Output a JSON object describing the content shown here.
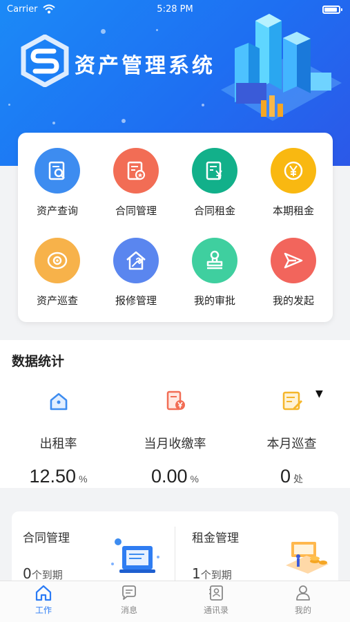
{
  "status_bar": {
    "carrier": "Carrier",
    "time": "5:28 PM"
  },
  "banner": {
    "title": "资产管理系统"
  },
  "quick_menu": [
    {
      "label": "资产查询",
      "icon": "search-doc-icon",
      "color": "#3d8cf0"
    },
    {
      "label": "合同管理",
      "icon": "contract-icon",
      "color": "#f26d55"
    },
    {
      "label": "合同租金",
      "icon": "rent-doc-icon",
      "color": "#12b08a"
    },
    {
      "label": "本期租金",
      "icon": "yen-icon",
      "color": "#f9b811"
    },
    {
      "label": "资产巡查",
      "icon": "eye-icon",
      "color": "#f7b24a"
    },
    {
      "label": "报修管理",
      "icon": "repair-house-icon",
      "color": "#5a86ef"
    },
    {
      "label": "我的审批",
      "icon": "stamp-icon",
      "color": "#3fcf9f"
    },
    {
      "label": "我的发起",
      "icon": "send-icon",
      "color": "#f2655c"
    }
  ],
  "stats": {
    "title": "数据统计",
    "items": [
      {
        "label": "出租率",
        "value": "12.50",
        "unit": "%",
        "icon": "house-icon",
        "color": "#3d8cf0"
      },
      {
        "label": "当月收缴率",
        "value": "0.00",
        "unit": "%",
        "icon": "bill-icon",
        "color": "#f26d55"
      },
      {
        "label": "本月巡查",
        "value": "0",
        "unit": "处",
        "icon": "checklist-icon",
        "color": "#f5b62a"
      }
    ]
  },
  "management": {
    "contract": {
      "title": "合同管理",
      "count": "0",
      "count_unit": "个到期"
    },
    "rent": {
      "title": "租金管理",
      "count": "1",
      "count_unit": "个到期"
    }
  },
  "tabs": [
    {
      "label": "工作",
      "icon": "home-icon",
      "active": true
    },
    {
      "label": "消息",
      "icon": "chat-icon",
      "active": false
    },
    {
      "label": "通讯录",
      "icon": "contacts-icon",
      "active": false
    },
    {
      "label": "我的",
      "icon": "person-icon",
      "active": false
    }
  ]
}
